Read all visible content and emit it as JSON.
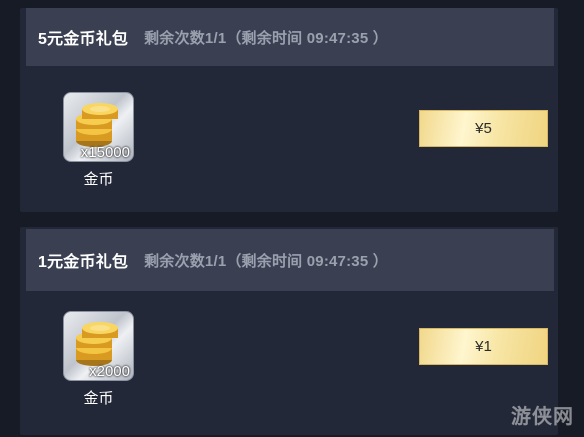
{
  "packs": [
    {
      "title": "5元金币礼包",
      "remaining": "剩余次数1/1（剩余时间 09:47:35 ）",
      "item": {
        "quantity": "x15000",
        "name": "金币",
        "icon": "gold-coin-stack-icon"
      },
      "price_label": "¥5"
    },
    {
      "title": "1元金币礼包",
      "remaining": "剩余次数1/1（剩余时间 09:47:35 ）",
      "item": {
        "quantity": "x2000",
        "name": "金币",
        "icon": "gold-coin-stack-icon"
      },
      "price_label": "¥1"
    }
  ],
  "watermark": "游侠网",
  "colors": {
    "background": "#161b26",
    "panel": "#222838",
    "header": "#3a4052",
    "gold": "#f1d88c"
  }
}
